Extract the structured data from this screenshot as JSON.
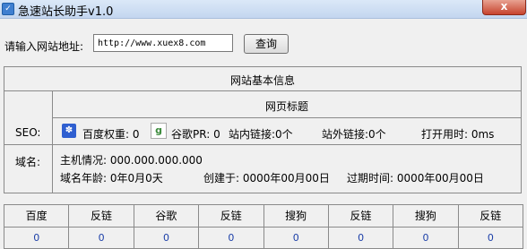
{
  "window": {
    "title": "急速站长助手v1.0",
    "app_icon": "app-logo-icon",
    "close_glyph": "x"
  },
  "search": {
    "label": "请输入网站地址:",
    "value": "http://www.xuex8.com",
    "button": "查询"
  },
  "info": {
    "header": "网站基本信息",
    "page_title_label": "网页标题",
    "seo": {
      "label": "SEO:",
      "baidu_icon": "baidu-paw-icon",
      "baidu_weight": "百度权重: 0",
      "google_icon": "google-icon",
      "google_pr": "谷歌PR: 0",
      "internal_links": "站内链接:0个",
      "external_links": "站外链接:0个",
      "load_time": "打开用时: 0ms"
    },
    "domain": {
      "label": "域名:",
      "host": "主机情况: 000.000.000.000",
      "age": "域名年龄: 0年0月0天",
      "created": "创建于: 0000年00月00日",
      "expires": "过期时间: 0000年00月00日"
    }
  },
  "stats": {
    "headers": [
      "百度",
      "反链",
      "谷歌",
      "反链",
      "搜狗",
      "反链",
      "搜狗",
      "反链"
    ],
    "values": [
      "0",
      "0",
      "0",
      "0",
      "0",
      "0",
      "0",
      "0"
    ]
  }
}
